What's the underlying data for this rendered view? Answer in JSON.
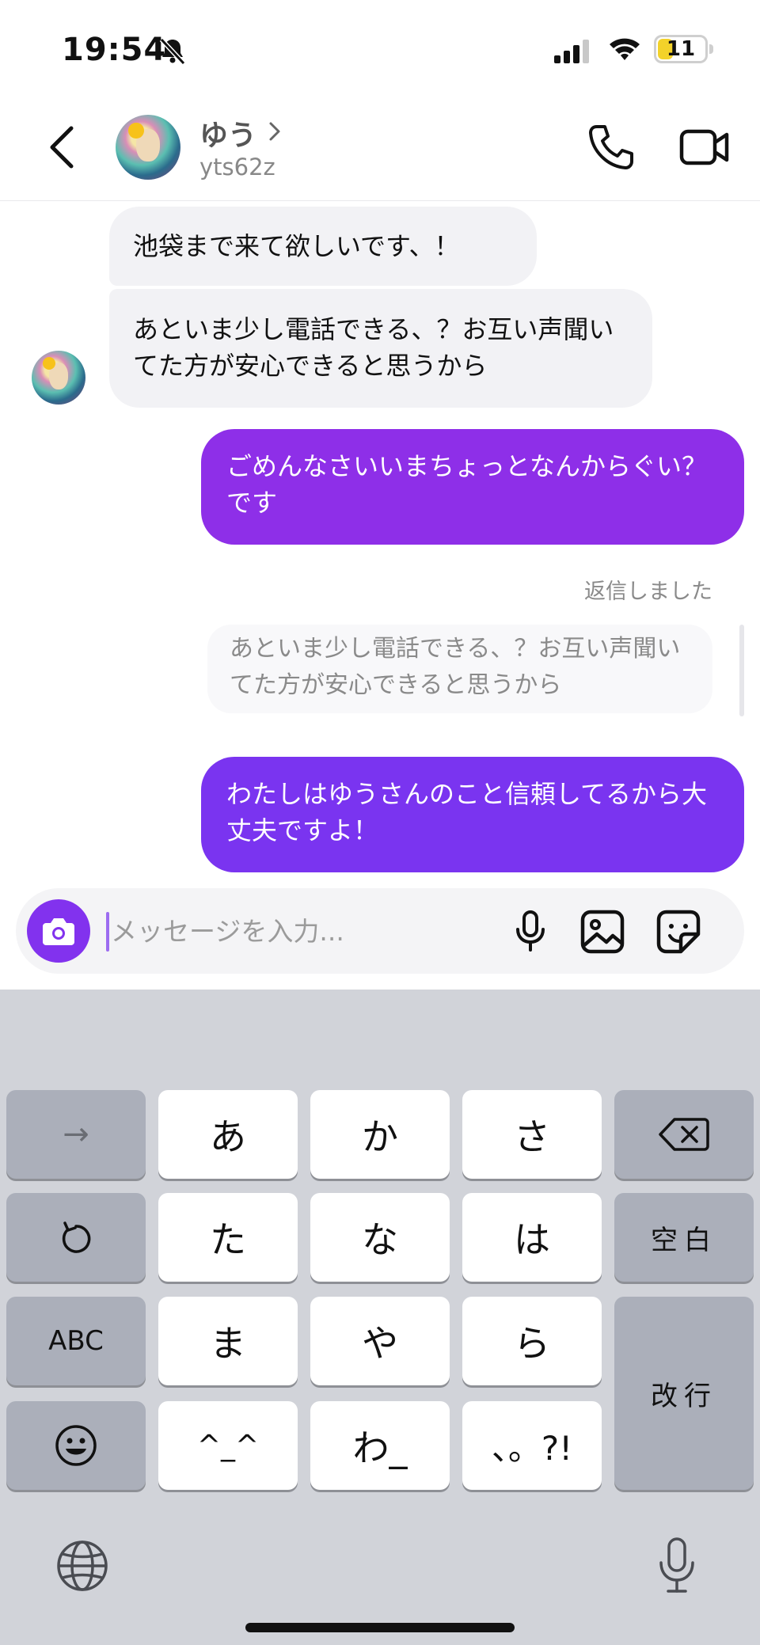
{
  "status_bar": {
    "time": "19:54",
    "battery": "11",
    "battery_level": 0.11,
    "icons": [
      "bell-slash-icon",
      "cellular-signal-icon",
      "wifi-icon",
      "battery-icon"
    ]
  },
  "header": {
    "contact_name": "ゆう",
    "handle": "yts62z",
    "icons": [
      "back-chevron-icon",
      "chevron-right-icon",
      "phone-icon",
      "video-camera-icon"
    ]
  },
  "messages": [
    {
      "direction": "incoming",
      "text": "池袋まで来て欲しいです、！"
    },
    {
      "direction": "incoming",
      "text": "あといま少し電話できる、？お互い声聞いてた方が安心できると思うから"
    },
    {
      "direction": "outgoing",
      "text": "ごめんなさいいまちょっとなんからぐい？です"
    },
    {
      "direction": "outgoing",
      "replied_label": "返信しました",
      "quoted_text": "あといま少し電話できる、？お互い声聞いてた方が安心できると思うから",
      "text": "わたしはゆうさんのこと信頼してるから大丈夫ですよ！"
    }
  ],
  "composer": {
    "placeholder": "メッセージを入力...",
    "value": "",
    "icons": [
      "camera-icon",
      "microphone-icon",
      "image-icon",
      "sticker-icon"
    ]
  },
  "colors": {
    "accent": "#8232ee",
    "outgoing_bubble_1": "#8e2fe8",
    "outgoing_bubble_2": "#7a34f0",
    "incoming_bubble": "#f2f2f5",
    "keyboard_bg": "#d1d3d9"
  },
  "keyboard": {
    "row1": [
      "→",
      "あ",
      "か",
      "さ",
      "⌫"
    ],
    "row2": [
      "↺",
      "た",
      "な",
      "は",
      "空白"
    ],
    "row3": [
      "ABC",
      "ま",
      "や",
      "ら",
      "改行"
    ],
    "row4": [
      "☺",
      "^_^",
      "わ_",
      "、。?!"
    ],
    "icons": [
      "globe-icon",
      "dictation-mic-icon"
    ]
  }
}
